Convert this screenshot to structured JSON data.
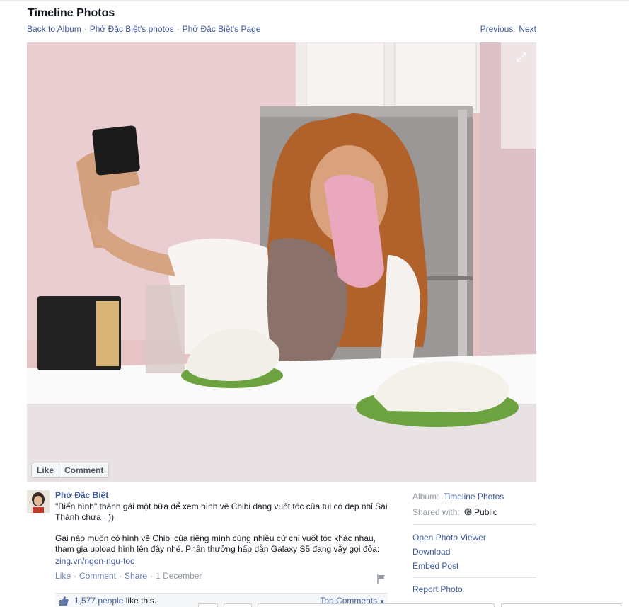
{
  "header": {
    "title": "Timeline Photos",
    "breadcrumbs": [
      "Back to Album",
      "Phở Đặc Biệt's photos",
      "Phở Đặc Biệt's Page"
    ],
    "previous_label": "Previous",
    "next_label": "Next"
  },
  "photo_actions": {
    "like_label": "Like",
    "comment_label": "Comment"
  },
  "post": {
    "author": "Phở Đặc Biệt",
    "caption_1": "\"Biến hình\" thành gái một bữa để xem hình vẽ Chibi đang vuốt tóc của tui có đẹp nhỉ Sài Thành chưa =))",
    "caption_2": "Gái nào muốn có hình vẽ Chibi của riêng mình cùng nhiều cử chỉ vuốt tóc khác nhau, tham gia upload hình lên đây nhé. Phần thưởng hấp dẫn Galaxy S5 đang vẫy gọi đỏa:",
    "caption_link": "zing.vn/ngon-ngu-toc",
    "like_action": "Like",
    "comment_action": "Comment",
    "share_action": "Share",
    "date": "1 December"
  },
  "likes": {
    "count_label": "1,577 people",
    "suffix": "like this.",
    "sort_label": "Top Comments"
  },
  "sidebar": {
    "album_label": "Album:",
    "album_value": "Timeline Photos",
    "shared_label": "Shared with:",
    "shared_value": "Public",
    "actions": [
      "Open Photo Viewer",
      "Download",
      "Embed Post",
      "Report Photo"
    ]
  },
  "icons": {
    "expand": "expand-icon",
    "flag": "flag-icon",
    "thumb": "thumbs-up-icon",
    "globe": "globe-icon"
  },
  "colors": {
    "link": "#3b5998",
    "muted": "#9197a3"
  }
}
